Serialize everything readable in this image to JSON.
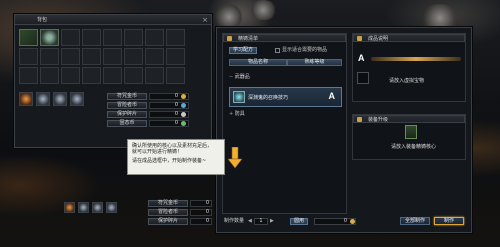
{
  "inventory": {
    "title": "背包",
    "close": "×",
    "currency_buttons": [
      {
        "label": "符咒金币",
        "value": "0"
      },
      {
        "label": "冒险者币",
        "value": "0"
      },
      {
        "label": "保护碎片",
        "value": "0"
      },
      {
        "label": "固态币",
        "value": "0"
      }
    ]
  },
  "crafting": {
    "list_header": "精铸清单",
    "learn_button": "学习配方",
    "show_only_label": "显示适合需要的物品",
    "columns": [
      "物品名称",
      "熟练等级"
    ],
    "category_1": "武器品",
    "recipe_name": "深渊鬼的召唤技巧",
    "recipe_grade": "A",
    "category_2": "防具",
    "info_header": "成品说明",
    "info_grade": "A",
    "input_label": "请放入虚拟宝物",
    "upgrade_header": "装备升级",
    "upgrade_label": "请放入装备精铸核心"
  },
  "tooltip": {
    "line1": "确认所使用的核心以及素材充足后，",
    "line2": "就可以开始进行精铸！",
    "line3": "请在成品选框中，开始制作装备~"
  },
  "footer": {
    "qty_label": "制作数量",
    "qty_value": "1",
    "qty_btn": "圆用",
    "money_value": "0",
    "craft_all_button": "全部制作",
    "craft_button": "制作"
  },
  "belt": {
    "labels": [
      "符咒金币",
      "冒险者币",
      "保护碎片"
    ],
    "values": [
      "0",
      "0",
      "0"
    ]
  },
  "colors": {
    "accent": "#e0a53a",
    "panel": "#14171b",
    "highlight": "#5d7892"
  }
}
